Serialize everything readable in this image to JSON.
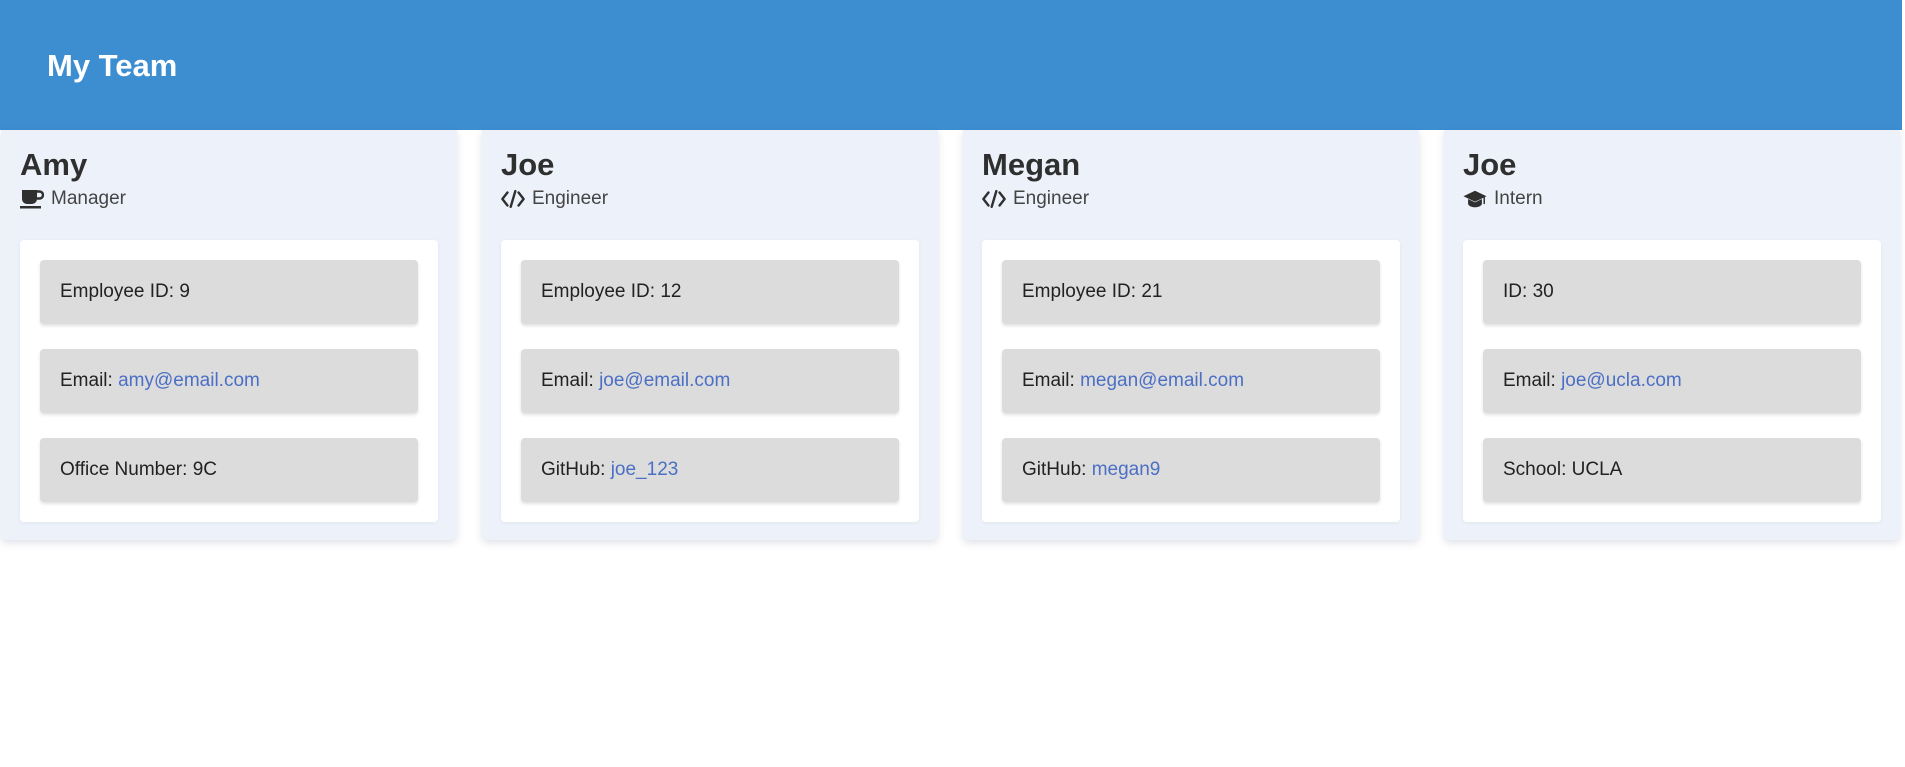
{
  "header": {
    "title": "My Team"
  },
  "colors": {
    "header_bg": "#3d8dd1",
    "card_bg": "#edf1f9",
    "item_bg": "#dcdcdc",
    "link": "#4b6fc5"
  },
  "cards": [
    {
      "name": "Amy",
      "role": "Manager",
      "role_icon": "coffee-mug-icon",
      "id_label": "Employee ID:",
      "id_value": "9",
      "email_label": "Email:",
      "email": "amy@email.com",
      "extra_label": "Office Number:",
      "extra_value": "9C"
    },
    {
      "name": "Joe",
      "role": "Engineer",
      "role_icon": "code-brackets-icon",
      "id_label": "Employee ID:",
      "id_value": "12",
      "email_label": "Email:",
      "email": "joe@email.com",
      "extra_label": "GitHub:",
      "extra_value": "joe_123"
    },
    {
      "name": "Megan",
      "role": "Engineer",
      "role_icon": "code-brackets-icon",
      "id_label": "Employee ID:",
      "id_value": "21",
      "email_label": "Email:",
      "email": "megan@email.com",
      "extra_label": "GitHub:",
      "extra_value": "megan9"
    },
    {
      "name": "Joe",
      "role": "Intern",
      "role_icon": "graduation-cap-icon",
      "id_label": "ID:",
      "id_value": "30",
      "email_label": "Email:",
      "email": "joe@ucla.com",
      "extra_label": "School:",
      "extra_value": "UCLA"
    }
  ]
}
